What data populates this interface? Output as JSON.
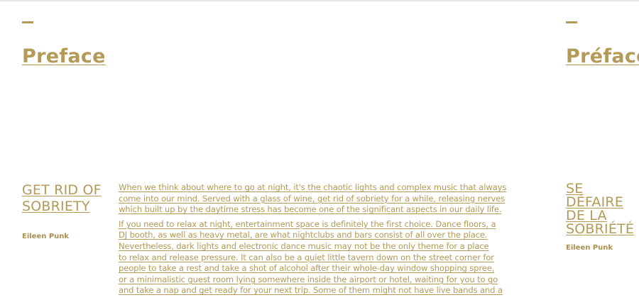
{
  "left": {
    "title": "Preface",
    "section_title_lines": [
      "GET RID OF",
      "SOBRIETY"
    ],
    "author": "Eileen Punk",
    "paragraphs": [
      [
        "When we think about where to go at night, it's the chaotic lights and complex music that always",
        "come into our mind. Served with a glass of wine, get rid of sobriety for a while, releasing nerves",
        "which built up by the daytime stress has become one of the significant aspects  in our daily life."
      ],
      [
        "If you need to relax at night, entertainment space is definitely the first choice. Dance floors, a",
        "DJ booth, as well as heavy metal, are what nightclubs and bars consist of all over the place.",
        "Nevertheless, dark lights and electronic dance music may not be the only theme for a place",
        "to relax and release pressure. It can also be a quiet little tavern down on the street corner for",
        "people to take a rest and take a shot of alcohol after their whole-day window shopping spree,",
        "or a minimalistic guest room lying somewhere inside the airport or hotel, waiting for you to go",
        "and take a nap and get ready for your next trip. Some of them might not have live bands and a"
      ]
    ]
  },
  "right": {
    "title": "Préface",
    "section_title_lines": [
      "SE DÉFAIRE",
      "DE LA",
      "SOBRIÉTÉ"
    ],
    "author": "Eileen Punk"
  }
}
